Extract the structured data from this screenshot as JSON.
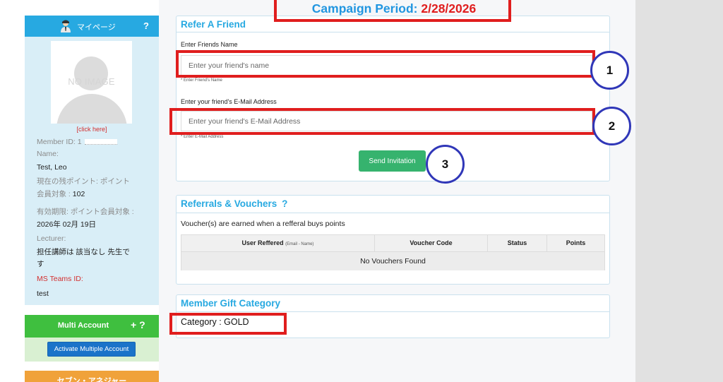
{
  "campaign": {
    "label": "Campaign Period: ",
    "date": "2/28/2026"
  },
  "sidebar": {
    "mypage_title": "マイページ",
    "help": "?",
    "no_image": "NO IMAGE",
    "click_here": "[click here]",
    "member_id_label": "Member ID: ",
    "member_id_value": "1",
    "name_label": "Name:",
    "name_value": "Test, Leo",
    "points_label": "現在の残ポイント: ポイント",
    "points_line2_label": "会員対象 : ",
    "points_line2_value": "102",
    "expiry_label": "有効期限: ポイント会員対象 :",
    "expiry_value": "2026年 02月 19日",
    "lecturer_label": "Lecturer:",
    "lecturer_line1": "担任講師は 該当なし 先生で",
    "lecturer_line2": "す",
    "ms_teams_label": "MS Teams ID:",
    "ms_teams_value": "test",
    "multi_account_title": "Multi Account",
    "multi_account_icons": "+ ?",
    "activate_button": "Activate Multiple Account",
    "next_section_title": "セブン・アネジャー"
  },
  "refer": {
    "title": "Refer A Friend",
    "name_label": "Enter Friends Name",
    "name_placeholder": "Enter your friend's name",
    "name_help": "* Enter Friend's Name",
    "email_label": "Enter your friend's E-Mail Address",
    "email_placeholder": "Enter your friend's E-Mail Address",
    "email_help": "* Enter E-Mail Address",
    "send_button": "Send Invitation"
  },
  "vouchers": {
    "title": "Referrals & Vouchers",
    "help": "?",
    "description": "Voucher(s) are earned when a refferal buys points",
    "columns": [
      {
        "label": "User Reffered",
        "sub": "(Email - Name)"
      },
      {
        "label": "Voucher Code",
        "sub": ""
      },
      {
        "label": "Status",
        "sub": ""
      },
      {
        "label": "Points",
        "sub": ""
      }
    ],
    "empty_text": "No Vouchers Found"
  },
  "gift": {
    "title": "Member Gift Category",
    "category": "Category : GOLD"
  },
  "annotations": {
    "step1": "1",
    "step2": "2",
    "step3": "3"
  },
  "colors": {
    "accent_blue": "#27a9e1",
    "annotation_red": "#e01e1e",
    "annotation_circle": "#3037b8",
    "send_green": "#36b36e",
    "multi_green": "#3fbf3f",
    "activate_blue": "#1a73c9",
    "orange": "#f0a23a"
  }
}
